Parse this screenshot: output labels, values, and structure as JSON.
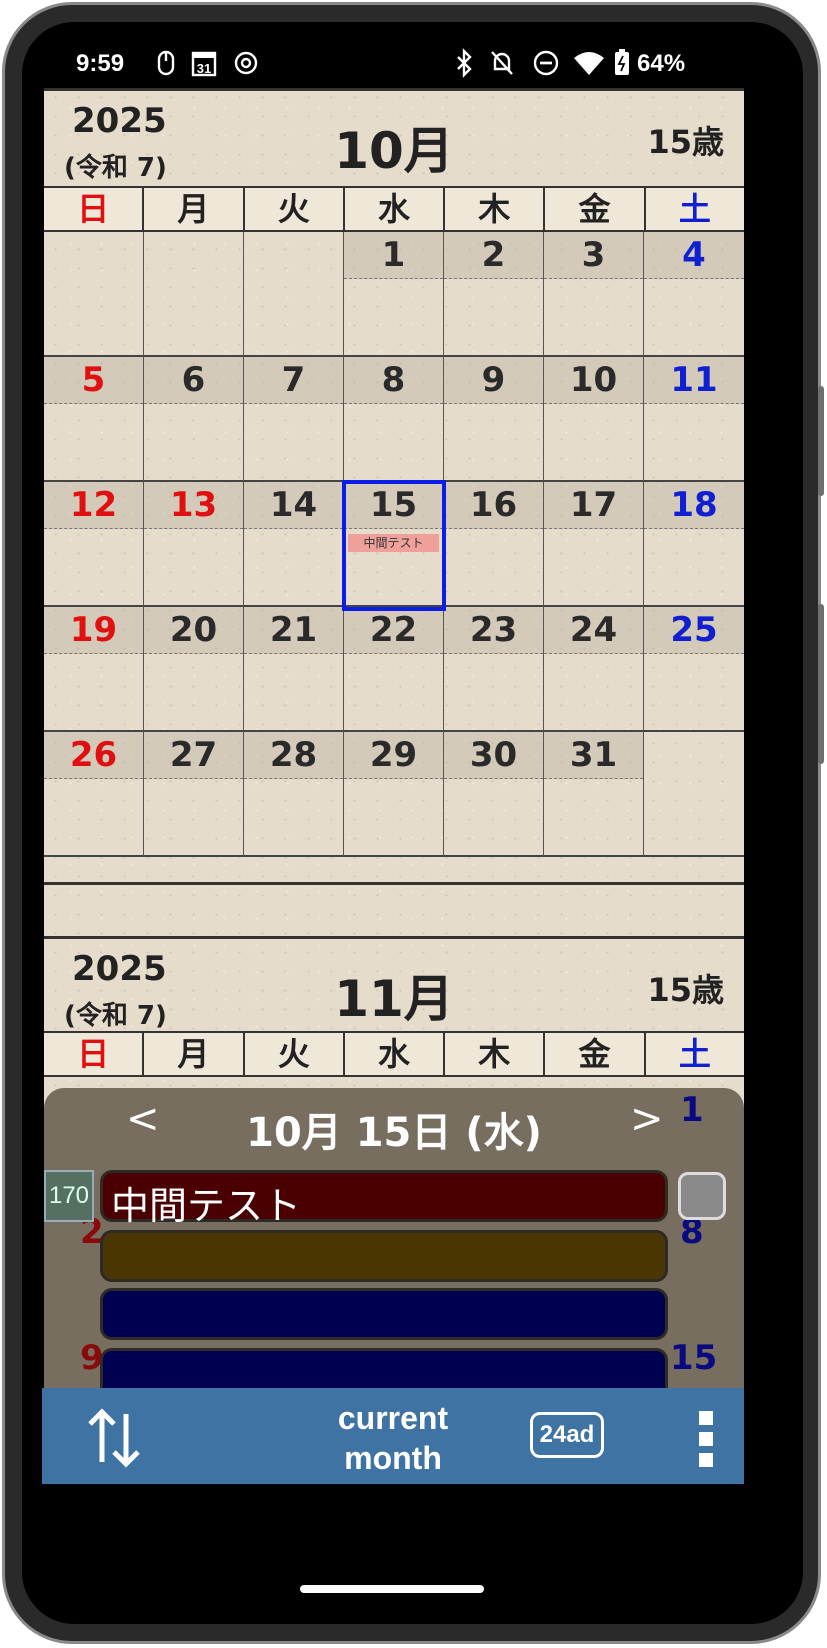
{
  "status_bar": {
    "time": "9:59",
    "battery": "64%"
  },
  "weekdays": [
    "日",
    "月",
    "火",
    "水",
    "木",
    "金",
    "土"
  ],
  "october": {
    "year": "2025",
    "era": "(令和 7)",
    "month": "10月",
    "age": "15歳",
    "weeks": [
      [
        "",
        "",
        "",
        "1",
        "2",
        "3",
        "4"
      ],
      [
        "5",
        "6",
        "7",
        "8",
        "9",
        "10",
        "11"
      ],
      [
        "12",
        "13",
        "14",
        "15",
        "16",
        "17",
        "18"
      ],
      [
        "19",
        "20",
        "21",
        "22",
        "23",
        "24",
        "25"
      ],
      [
        "26",
        "27",
        "28",
        "29",
        "30",
        "31",
        ""
      ]
    ],
    "event_on_15": "中間テスト"
  },
  "november": {
    "year": "2025",
    "era": "(令和 7)",
    "month": "11月",
    "age": "15歳"
  },
  "panel": {
    "prev": "<",
    "next": ">",
    "date": "10月 15日 (水)",
    "badge": "170",
    "event_title": "中間テスト",
    "peek_numbers": {
      "sat1": "1",
      "sun2": "2",
      "sat8": "8",
      "sun9": "9",
      "sat15": "15"
    }
  },
  "toolbar": {
    "current_line1": "current",
    "current_line2": "month",
    "badge_24ad": "24ad"
  },
  "colors": {
    "toolbar": "#3f73a4",
    "event1": "#4a0000",
    "event2": "#4a3600",
    "event3": "#000050",
    "event4": "#000050",
    "selected": "#0a1ee6"
  }
}
